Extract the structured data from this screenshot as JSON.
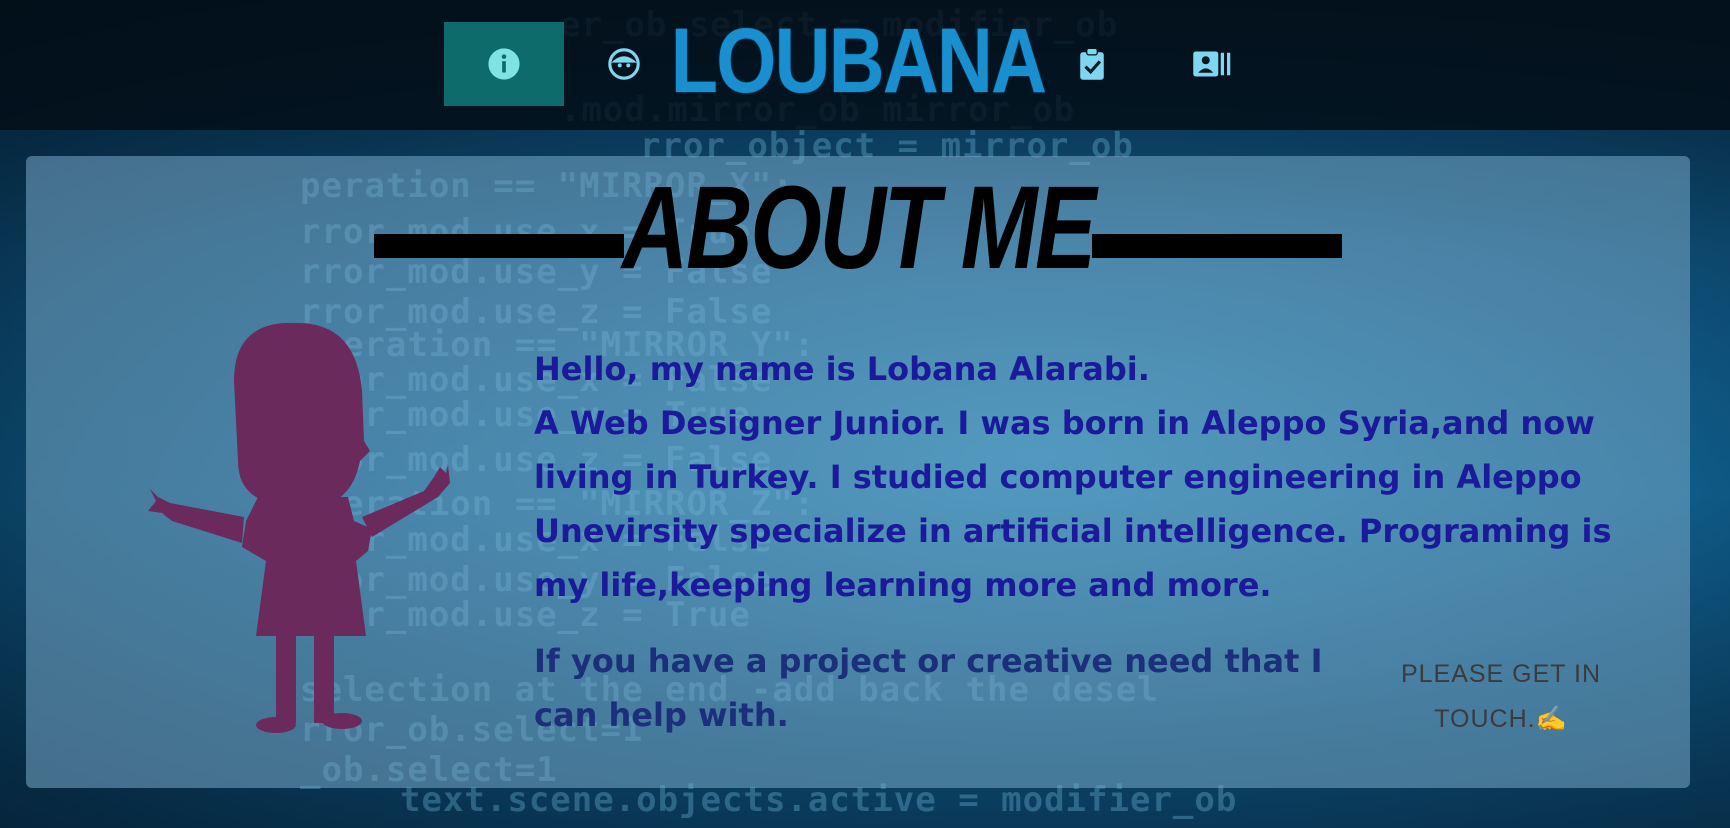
{
  "nav": {
    "items": [
      {
        "id": "about",
        "icon": "info-icon",
        "active": true
      },
      {
        "id": "face",
        "icon": "face-icon",
        "active": false
      },
      {
        "id": "tasks",
        "icon": "clipboard-check-icon",
        "active": false
      },
      {
        "id": "contact",
        "icon": "contact-card-icon",
        "active": false
      }
    ],
    "logo": "LOUBANA"
  },
  "about": {
    "heading": "ABOUT ME",
    "intro": "Hello, my name is Lobana Alarabi.\nA Web Designer Junior. I was born in Aleppo Syria,and now living in Turkey. I studied computer engineering in Aleppo Unevirsity specialize in artificial intelligence. Programing is my life,keeping learning more and more.",
    "cta": "If you have a project or creative need that I can help with.",
    "contact_link": "PLEASE GET IN TOUCH.✍"
  },
  "colors": {
    "accent": "#0d6b6c",
    "logo": "#1a8fd0",
    "intro_text": "#1a1a9a",
    "silhouette": "#6b2a5c"
  }
}
